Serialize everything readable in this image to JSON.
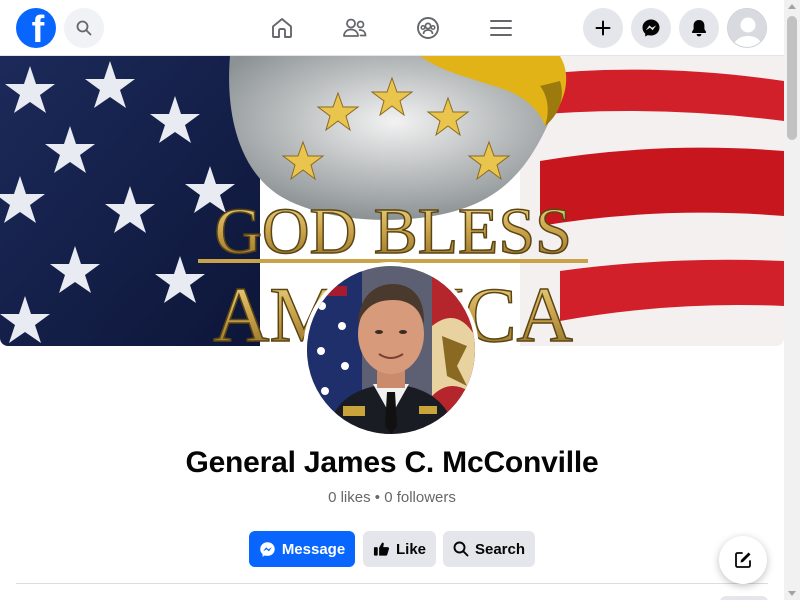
{
  "nav": {
    "logo_glyph": "f",
    "icons": {
      "search": "search-icon",
      "home": "home-icon",
      "friends": "friends-icon",
      "groups": "groups-icon",
      "menu": "menu-icon",
      "create": "plus-icon",
      "messenger": "messenger-icon",
      "notifications": "bell-icon",
      "account": "avatar"
    }
  },
  "cover": {
    "banner_line1": "GOD BLESS",
    "banner_line2": "AMERICA"
  },
  "profile": {
    "name": "General James C. McConville",
    "stats": "0 likes • 0 followers"
  },
  "actions": {
    "message_label": "Message",
    "like_label": "Like",
    "search_label": "Search"
  },
  "colors": {
    "brand_blue": "#0866ff",
    "secondary_button": "#e4e6eb",
    "text_primary": "#050505",
    "text_secondary": "#65676b"
  }
}
